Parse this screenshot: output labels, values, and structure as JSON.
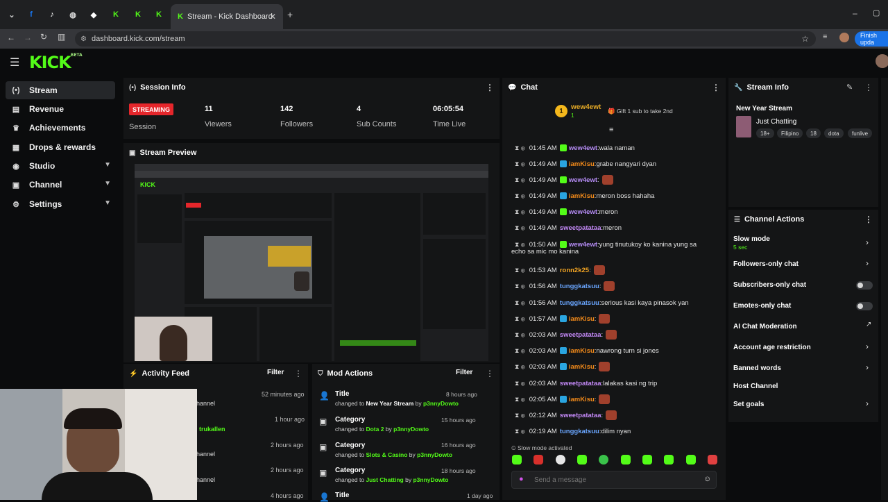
{
  "browser": {
    "tab_title": "Stream - Kick Dashboard",
    "url": "dashboard.kick.com/stream",
    "finish_update": "Finish upda"
  },
  "brand": {
    "logo": "KICK",
    "beta": "BETA"
  },
  "sidebar": {
    "items": [
      {
        "label": "Stream",
        "icon": "broadcast-icon"
      },
      {
        "label": "Revenue",
        "icon": "revenue-icon"
      },
      {
        "label": "Achievements",
        "icon": "trophy-icon"
      },
      {
        "label": "Drops & rewards",
        "icon": "gift-icon"
      },
      {
        "label": "Studio",
        "icon": "studio-icon"
      },
      {
        "label": "Channel",
        "icon": "channel-icon"
      },
      {
        "label": "Settings",
        "icon": "gear-icon"
      }
    ]
  },
  "session": {
    "title": "Session Info",
    "status": "STREAMING",
    "session_label": "Session",
    "stats": [
      {
        "value": "11",
        "label": "Viewers"
      },
      {
        "value": "142",
        "label": "Followers"
      },
      {
        "value": "4",
        "label": "Sub Counts"
      },
      {
        "value": "06:05:54",
        "label": "Time Live"
      }
    ]
  },
  "preview": {
    "title": "Stream Preview"
  },
  "activity": {
    "title": "Activity Feed",
    "filter": "Filter",
    "items": [
      {
        "text": "hannel",
        "time": "52 minutes ago"
      },
      {
        "text": "trukallen",
        "time": "1 hour ago"
      },
      {
        "text": "hannel",
        "time": "2 hours ago"
      },
      {
        "text": "hannel",
        "time": "2 hours ago"
      },
      {
        "text": "",
        "time": "4 hours ago"
      }
    ]
  },
  "mod_actions": {
    "title": "Mod Actions",
    "filter": "Filter",
    "items": [
      {
        "title": "Title",
        "prefix": "changed to ",
        "value": "New Year Stream",
        "by": " by ",
        "user": "p3nnyDowto",
        "time": "8 hours ago"
      },
      {
        "title": "Category",
        "prefix": "changed to ",
        "value": "Dota 2",
        "by": " by ",
        "user": "p3nnyDowto",
        "time": "15 hours ago"
      },
      {
        "title": "Category",
        "prefix": "changed to ",
        "value": "Slots & Casino",
        "by": " by ",
        "user": "p3nnyDowto",
        "time": "16 hours ago"
      },
      {
        "title": "Category",
        "prefix": "changed to ",
        "value": "Just Chatting",
        "by": " by ",
        "user": "p3nnyDowto",
        "time": "18 hours ago"
      },
      {
        "title": "Title",
        "prefix": "",
        "value": "",
        "by": "",
        "user": "",
        "time": "1 day ago"
      }
    ]
  },
  "chat": {
    "title": "Chat",
    "top_gifter": "wew4ewt",
    "gifter_count": "1",
    "gift_prompt": "Gift 1 sub to take 2nd",
    "messages": [
      {
        "time": "01:45 AM",
        "user": "wew4ewt",
        "color": "#b58cf5",
        "badge": "g",
        "text": "wala naman",
        "emote": false
      },
      {
        "time": "01:49 AM",
        "user": "iamKisu",
        "color": "#f28a1a",
        "badge": "b",
        "text": "grabe nangyari dyan",
        "emote": false
      },
      {
        "time": "01:49 AM",
        "user": "wew4ewt",
        "color": "#b58cf5",
        "badge": "g",
        "text": "",
        "emote": true
      },
      {
        "time": "01:49 AM",
        "user": "iamKisu",
        "color": "#f28a1a",
        "badge": "b",
        "text": "meron boss hahaha",
        "emote": false
      },
      {
        "time": "01:49 AM",
        "user": "wew4ewt",
        "color": "#b58cf5",
        "badge": "g",
        "text": "meron",
        "emote": false
      },
      {
        "time": "01:49 AM",
        "user": "sweetpatataa",
        "color": "#c58af9",
        "badge": "",
        "text": "meron",
        "emote": false
      },
      {
        "time": "01:50 AM",
        "user": "wew4ewt",
        "color": "#b58cf5",
        "badge": "g",
        "text": "yung tinutukoy ko kanina yung sa",
        "emote": false
      },
      {
        "time": "01:53 AM",
        "user": "ronn2k25",
        "color": "#f5a623",
        "badge": "",
        "text": "",
        "emote": true
      },
      {
        "time": "01:56 AM",
        "user": "tunggkatsuu",
        "color": "#6aa6ff",
        "badge": "",
        "text": "",
        "emote": true
      },
      {
        "time": "01:56 AM",
        "user": "tunggkatsuu",
        "color": "#6aa6ff",
        "badge": "",
        "text": "serious kasi kaya pinasok yan",
        "emote": false
      },
      {
        "time": "01:57 AM",
        "user": "iamKisu",
        "color": "#f28a1a",
        "badge": "b",
        "text": "",
        "emote": true
      },
      {
        "time": "02:03 AM",
        "user": "sweetpatataa",
        "color": "#c58af9",
        "badge": "",
        "text": "",
        "emote": true
      },
      {
        "time": "02:03 AM",
        "user": "iamKisu",
        "color": "#f28a1a",
        "badge": "b",
        "text": "nawrong turn si jones",
        "emote": false
      },
      {
        "time": "02:03 AM",
        "user": "iamKisu",
        "color": "#f28a1a",
        "badge": "b",
        "text": "",
        "emote": true
      },
      {
        "time": "02:03 AM",
        "user": "sweetpatataa",
        "color": "#c58af9",
        "badge": "",
        "text": "lalakas kasi ng trip",
        "emote": false
      },
      {
        "time": "02:05 AM",
        "user": "iamKisu",
        "color": "#f28a1a",
        "badge": "b",
        "text": "",
        "emote": true
      },
      {
        "time": "02:12 AM",
        "user": "sweetpatataa",
        "color": "#c58af9",
        "badge": "",
        "text": "",
        "emote": true
      },
      {
        "time": "02:19 AM",
        "user": "tunggkatsuu",
        "color": "#6aa6ff",
        "badge": "",
        "text": "dilim nyan",
        "emote": false
      }
    ],
    "wrapped_line": "echo sa mic mo kanina",
    "slow_mode_notice": "Slow mode activated",
    "input_placeholder": "Send a message"
  },
  "stream_info": {
    "title": "Stream Info",
    "stream_title": "New Year Stream",
    "category": "Just Chatting",
    "tags": [
      "18+",
      "Filipino",
      "18",
      "dota",
      "funlive"
    ]
  },
  "channel_actions": {
    "title": "Channel Actions",
    "slow_mode": "Slow mode",
    "slow_mode_value": "5 sec",
    "items": [
      {
        "label": "Followers-only chat",
        "control": "arrow"
      },
      {
        "label": "Subscribers-only chat",
        "control": "toggle"
      },
      {
        "label": "Emotes-only chat",
        "control": "toggle"
      },
      {
        "label": "AI Chat Moderation",
        "control": "external"
      },
      {
        "label": "Account age restriction",
        "control": "arrow"
      },
      {
        "label": "Banned words",
        "control": "arrow"
      },
      {
        "label": "Host Channel",
        "control": "none"
      },
      {
        "label": "Set goals",
        "control": "arrow"
      }
    ]
  }
}
